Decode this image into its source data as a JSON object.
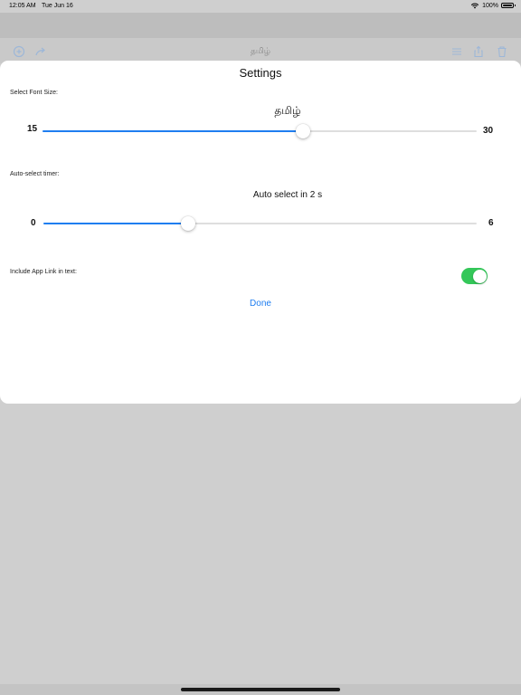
{
  "status_bar": {
    "time": "12:05 AM",
    "date": "Tue Jun 16",
    "battery": "100%"
  },
  "toolbar": {
    "title": "தமிழ்"
  },
  "settings": {
    "title": "Settings",
    "font_size": {
      "label": "Select Font Size:",
      "preview": "தமிழ்",
      "min_label": "15",
      "max_label": "30",
      "min": 15,
      "max": 30,
      "value": 24
    },
    "timer": {
      "label": "Auto-select timer:",
      "status": "Auto select in 2 s",
      "min_label": "0",
      "max_label": "6",
      "min": 0,
      "max": 6,
      "value": 2
    },
    "app_link": {
      "label": "Include App Link in text:",
      "enabled": true
    },
    "done_label": "Done"
  },
  "colors": {
    "accent": "#1f7ef0",
    "toggle_on": "#34c759",
    "dim_icon": "#9db7d8"
  }
}
